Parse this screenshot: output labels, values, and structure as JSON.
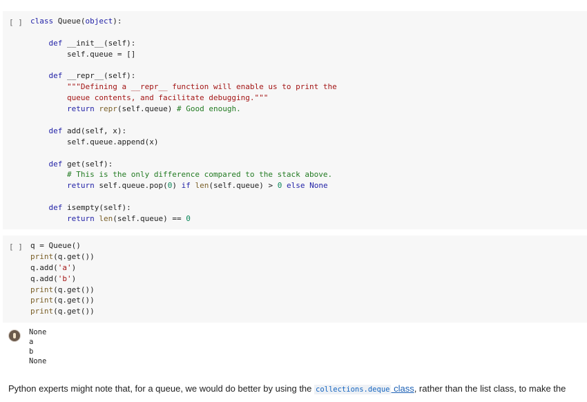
{
  "cell1": {
    "run_label": "[ ]",
    "lines": [
      "class Queue(object):",
      "",
      "    def __init__(self):",
      "        self.queue = []",
      "",
      "    def __repr__(self):",
      "        \"\"\"Defining a __repr__ function will enable us to print the",
      "        queue contents, and facilitate debugging.\"\"\"",
      "        return repr(self.queue) # Good enough.",
      "",
      "    def add(self, x):",
      "        self.queue.append(x)",
      "",
      "    def get(self):",
      "        # This is the only difference compared to the stack above.",
      "        return self.queue.pop(0) if len(self.queue) > 0 else None",
      "",
      "    def isempty(self):",
      "        return len(self.queue) == 0"
    ]
  },
  "cell2": {
    "run_label": "[ ]",
    "lines": [
      "q = Queue()",
      "print(q.get())",
      "q.add('a')",
      "q.add('b')",
      "print(q.get())",
      "print(q.get())",
      "print(q.get())"
    ]
  },
  "output": {
    "icon": "user-avatar-icon",
    "lines": [
      "None",
      "a",
      "b",
      "None"
    ]
  },
  "text_cell": {
    "before": "Python experts might note that, for a queue, we would do better by using the ",
    "code": "collections.deque",
    "link": " class",
    "after": ", rather than the list class, to make the"
  },
  "colors": {
    "keyword": "#1f1fa6",
    "string": "#a31515",
    "comment": "#217a21",
    "number": "#098658",
    "builtin": "#795e26"
  }
}
